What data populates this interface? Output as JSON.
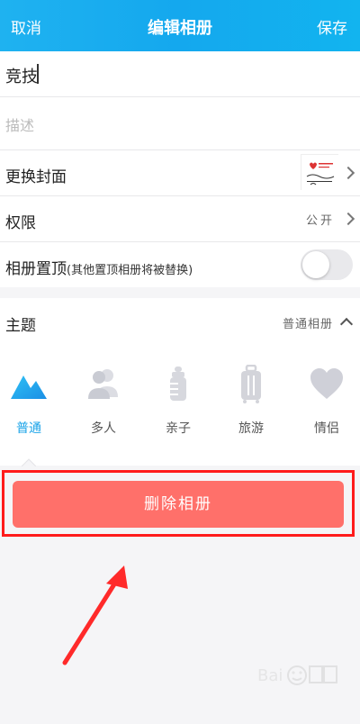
{
  "header": {
    "cancel_label": "取消",
    "title": "编辑相册",
    "save_label": "保存"
  },
  "album": {
    "name_value": "竞技",
    "description_placeholder": "描述"
  },
  "settings": {
    "change_cover_label": "更换封面",
    "permission_label": "权限",
    "permission_value": "公开",
    "pin_label": "相册置顶",
    "pin_note": "(其他置顶相册将被替换)",
    "pin_enabled": false
  },
  "theme": {
    "label": "主题",
    "value": "普通相册",
    "options": [
      {
        "label": "普通",
        "icon": "mountain-icon",
        "active": true
      },
      {
        "label": "多人",
        "icon": "people-icon",
        "active": false
      },
      {
        "label": "亲子",
        "icon": "baby-bottle-icon",
        "active": false
      },
      {
        "label": "旅游",
        "icon": "suitcase-icon",
        "active": false
      },
      {
        "label": "情侣",
        "icon": "heart-icon",
        "active": false
      }
    ]
  },
  "actions": {
    "delete_label": "删除相册"
  },
  "colors": {
    "header_blue": "#14a8ee",
    "active_theme": "#1aa3e8",
    "delete_button": "#ff706a",
    "annotation_red": "#ff1b1b"
  }
}
